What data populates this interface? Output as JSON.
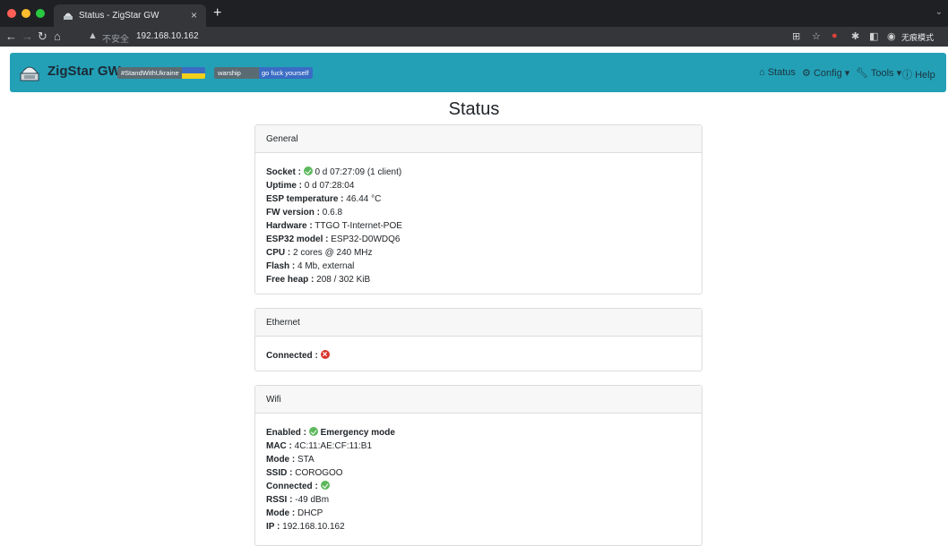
{
  "browser": {
    "tab_title": "Status - ZigStar GW",
    "tab_close": "×",
    "new_tab": "+",
    "insecure_label": "不安全",
    "url": "192.168.10.162",
    "incognito_label": "无痕模式",
    "traffic_colors": [
      "#ff5f57",
      "#febc2e",
      "#28c840"
    ]
  },
  "navbar": {
    "brand": "ZigStar GW",
    "badge_ukraine": "#StandWithUkraine",
    "badge_warship_left": "warship",
    "badge_warship_right": "go fuck yourself",
    "links": {
      "status": "Status",
      "config": "Config",
      "tools": "Tools",
      "help": "Help"
    },
    "accent": "#23a0b6"
  },
  "page": {
    "title": "Status"
  },
  "general": {
    "title": "General",
    "rows": [
      {
        "label": "Socket :",
        "value": "0 d 07:27:09 (1 client)"
      },
      {
        "label": "Uptime :",
        "value": "0 d 07:28:04"
      },
      {
        "label": "ESP temperature :",
        "value": "46.44 °C"
      },
      {
        "label": "FW version :",
        "value": "0.6.8"
      },
      {
        "label": "Hardware :",
        "value": "TTGO T-Internet-POE"
      },
      {
        "label": "ESP32 model :",
        "value": "ESP32-D0WDQ6"
      },
      {
        "label": "CPU :",
        "value": "2 cores @ 240 MHz"
      },
      {
        "label": "Flash :",
        "value": "4 Mb, external"
      },
      {
        "label": "Free heap :",
        "value": "208 / 302 KiB"
      }
    ]
  },
  "ethernet": {
    "title": "Ethernet",
    "connected_label": "Connected :"
  },
  "wifi": {
    "title": "Wifi",
    "enabled_label": "Enabled :",
    "enabled_value": "Emergency mode",
    "rows": [
      {
        "label": "MAC :",
        "value": "4C:11:AE:CF:11:B1"
      },
      {
        "label": "Mode :",
        "value": "STA"
      },
      {
        "label": "SSID :",
        "value": "COROGOO"
      }
    ],
    "connected_label": "Connected :",
    "rows2": [
      {
        "label": "RSSI :",
        "value": "-49 dBm"
      },
      {
        "label": "Mode :",
        "value": "DHCP"
      },
      {
        "label": "IP :",
        "value": "192.168.10.162"
      }
    ]
  }
}
